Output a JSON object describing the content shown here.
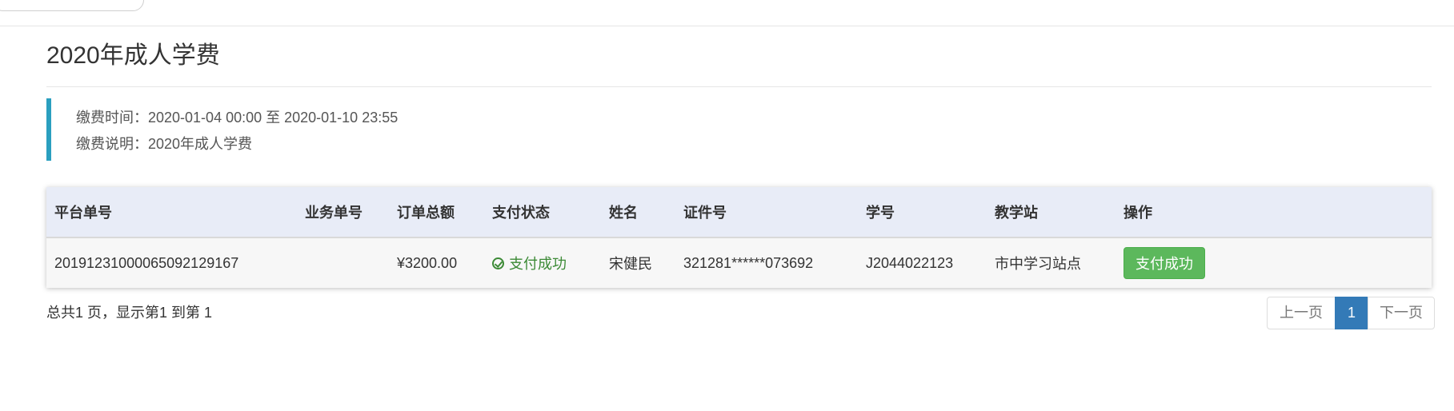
{
  "page": {
    "title": "2020年成人学费"
  },
  "info": {
    "time_line": "缴费时间：2020-01-04 00:00 至 2020-01-10 23:55",
    "desc_line": "缴费说明：2020年成人学费"
  },
  "table": {
    "headers": [
      "平台单号",
      "业务单号",
      "订单总额",
      "支付状态",
      "姓名",
      "证件号",
      "学号",
      "教学站",
      "操作"
    ],
    "rows": [
      {
        "platform_no": "201912310000650921291​67",
        "business_no": "",
        "amount": "¥3200.00",
        "status": "支付成功",
        "name": "宋健民",
        "id_no": "321281******073692",
        "student_no": "J2044022123",
        "station": "市中学习站点",
        "action_label": "支付成功"
      }
    ]
  },
  "footer": {
    "summary": "总共1 页，显示第1 到第 1"
  },
  "pagination": {
    "prev_label": "上一页",
    "current_page": "1",
    "next_label": "下一页"
  },
  "colors": {
    "accent_bar": "#2a9fbf",
    "success_green": "#5cb85c",
    "status_text_green": "#3c8a36",
    "pager_active": "#337ab7",
    "table_header_bg": "#e8ecf7"
  },
  "icons": {
    "status_icon": "check-circle-icon"
  }
}
